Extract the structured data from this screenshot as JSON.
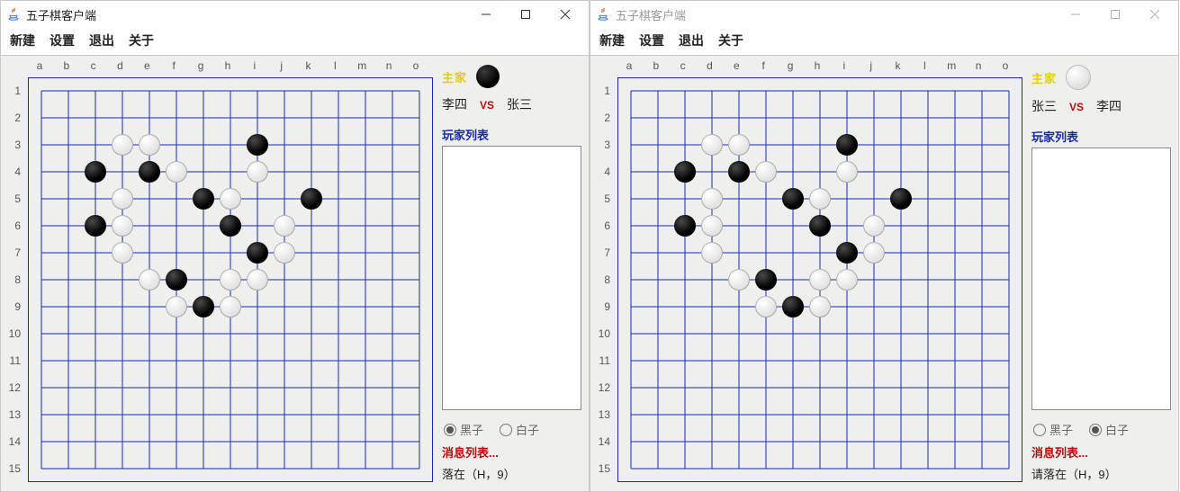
{
  "windows": [
    {
      "id": "left",
      "active": true,
      "title": "五子棋客户端",
      "menu": [
        "新建",
        "设置",
        "退出",
        "关于"
      ],
      "side": {
        "turn_label": "主家",
        "turn_color": "black",
        "player1": "李四",
        "vs": "VS",
        "player2": "张三",
        "player_list_label": "玩家列表",
        "radio_black": "黑子",
        "radio_white": "白子",
        "radio_selected": "black",
        "msg_label": "消息列表...",
        "status": "落在（H，9）"
      }
    },
    {
      "id": "right",
      "active": false,
      "title": "五子棋客户端",
      "menu": [
        "新建",
        "设置",
        "退出",
        "关于"
      ],
      "side": {
        "turn_label": "主家",
        "turn_color": "white",
        "player1": "张三",
        "vs": "VS",
        "player2": "李四",
        "player_list_label": "玩家列表",
        "radio_black": "黑子",
        "radio_white": "白子",
        "radio_selected": "white",
        "msg_label": "消息列表...",
        "status": "请落在（H，9）"
      }
    }
  ],
  "board": {
    "columns": [
      "a",
      "b",
      "c",
      "d",
      "e",
      "f",
      "g",
      "h",
      "i",
      "j",
      "k",
      "l",
      "m",
      "n",
      "o"
    ],
    "rows": [
      "1",
      "2",
      "3",
      "4",
      "5",
      "6",
      "7",
      "8",
      "9",
      "10",
      "11",
      "12",
      "13",
      "14",
      "15"
    ],
    "stones": [
      {
        "c": "d",
        "r": 3,
        "color": "wt"
      },
      {
        "c": "e",
        "r": 3,
        "color": "wt"
      },
      {
        "c": "i",
        "r": 3,
        "color": "bk"
      },
      {
        "c": "c",
        "r": 4,
        "color": "bk"
      },
      {
        "c": "e",
        "r": 4,
        "color": "bk"
      },
      {
        "c": "f",
        "r": 4,
        "color": "wt"
      },
      {
        "c": "i",
        "r": 4,
        "color": "wt"
      },
      {
        "c": "d",
        "r": 5,
        "color": "wt"
      },
      {
        "c": "g",
        "r": 5,
        "color": "bk"
      },
      {
        "c": "h",
        "r": 5,
        "color": "wt"
      },
      {
        "c": "k",
        "r": 5,
        "color": "bk"
      },
      {
        "c": "c",
        "r": 6,
        "color": "bk"
      },
      {
        "c": "d",
        "r": 6,
        "color": "wt"
      },
      {
        "c": "h",
        "r": 6,
        "color": "bk"
      },
      {
        "c": "j",
        "r": 6,
        "color": "wt"
      },
      {
        "c": "d",
        "r": 7,
        "color": "wt"
      },
      {
        "c": "i",
        "r": 7,
        "color": "bk"
      },
      {
        "c": "j",
        "r": 7,
        "color": "wt"
      },
      {
        "c": "e",
        "r": 8,
        "color": "wt"
      },
      {
        "c": "f",
        "r": 8,
        "color": "bk"
      },
      {
        "c": "h",
        "r": 8,
        "color": "wt"
      },
      {
        "c": "i",
        "r": 8,
        "color": "wt"
      },
      {
        "c": "f",
        "r": 9,
        "color": "wt"
      },
      {
        "c": "g",
        "r": 9,
        "color": "bk"
      },
      {
        "c": "h",
        "r": 9,
        "color": "wt"
      }
    ]
  }
}
